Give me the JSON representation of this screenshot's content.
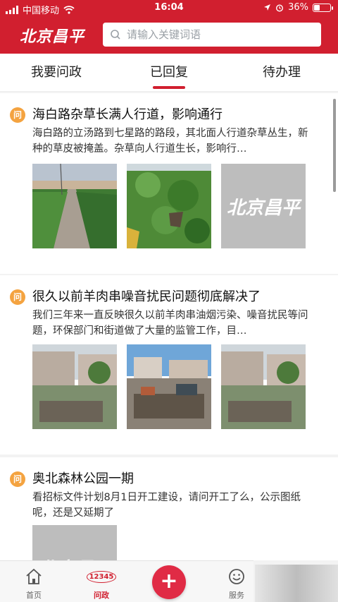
{
  "status_bar": {
    "carrier": "中国移动",
    "time": "16:04",
    "battery": "36%",
    "battery_level": 0.36
  },
  "header": {
    "brand": "北京昌平",
    "search_placeholder": "请输入关键词语"
  },
  "tabs": [
    {
      "label": "我要问政",
      "active": false
    },
    {
      "label": "已回复",
      "active": true
    },
    {
      "label": "待办理",
      "active": false
    }
  ],
  "posts": [
    {
      "badge": "问",
      "title": "海白路杂草长满人行道，影响通行",
      "summary": "海白路的立汤路到七星路的路段，其北面人行道杂草丛生，新种的草皮被掩盖。杂草向人行道生长，影响行…",
      "images": [
        "sidewalk-photo",
        "weeds-photo",
        "placeholder"
      ],
      "placeholder_text": "北京昌平"
    },
    {
      "badge": "问",
      "title": "很久以前羊肉串噪音扰民问题彻底解决了",
      "summary": "我们三年来一直反映很久以前羊肉串油烟污染、噪音扰民等问题，环保部门和街道做了大量的监管工作，目…",
      "images": [
        "construction-photo-1",
        "rooftop-photo",
        "construction-photo-2"
      ]
    },
    {
      "badge": "问",
      "title": "奥北森林公园一期",
      "summary": "看招标文件计划8月1日开工建设，请问开工了么，公示图纸呢，还是又延期了",
      "images": [
        "placeholder"
      ],
      "placeholder_text": "北京昌平"
    }
  ],
  "bottom_nav": [
    {
      "label": "首页",
      "icon": "home-icon",
      "active": false
    },
    {
      "label": "问政",
      "icon": "12345-icon",
      "active": true,
      "icon_text": "12345"
    },
    {
      "label": "服务",
      "icon": "smile-icon",
      "active": false
    }
  ],
  "fab": {
    "icon": "plus-icon",
    "symbol": "+"
  },
  "colors": {
    "brand_red": "#d11f2f",
    "fab_red": "#e02b45",
    "badge_orange": "#f4a340"
  }
}
